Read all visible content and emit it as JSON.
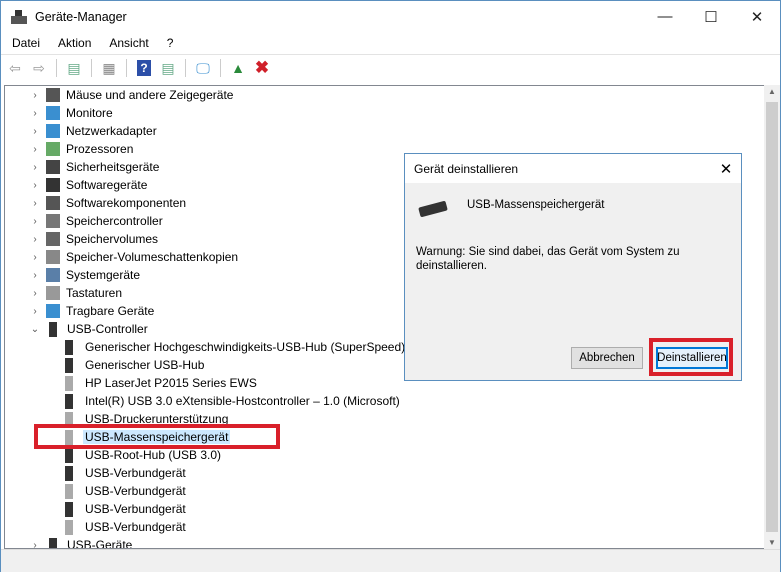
{
  "window": {
    "title": "Geräte-Manager",
    "minimize": "—",
    "maximize": "☐",
    "close": "✕"
  },
  "menu": [
    "Datei",
    "Aktion",
    "Ansicht",
    "?"
  ],
  "toolbar": {
    "icons": [
      "back-icon",
      "forward-icon",
      "show-hide-console-tree-icon",
      "properties-icon",
      "help-icon",
      "action-pane-icon",
      "scan-hardware-icon",
      "update-driver-icon",
      "uninstall-icon"
    ]
  },
  "tree": {
    "categories": [
      {
        "label": "Mäuse und andere Zeigegeräte",
        "icon": "mouse-icon"
      },
      {
        "label": "Monitore",
        "icon": "monitor-icon"
      },
      {
        "label": "Netzwerkadapter",
        "icon": "network-icon"
      },
      {
        "label": "Prozessoren",
        "icon": "processor-icon"
      },
      {
        "label": "Sicherheitsgeräte",
        "icon": "security-icon"
      },
      {
        "label": "Softwaregeräte",
        "icon": "software-device-icon"
      },
      {
        "label": "Softwarekomponenten",
        "icon": "software-component-icon"
      },
      {
        "label": "Speichercontroller",
        "icon": "storage-controller-icon"
      },
      {
        "label": "Speichervolumes",
        "icon": "storage-volume-icon"
      },
      {
        "label": "Speicher-Volumeschattenkopien",
        "icon": "shadow-copy-icon"
      },
      {
        "label": "Systemgeräte",
        "icon": "system-icon"
      },
      {
        "label": "Tastaturen",
        "icon": "keyboard-icon"
      },
      {
        "label": "Tragbare Geräte",
        "icon": "portable-device-icon"
      }
    ],
    "usb_controller": {
      "label": "USB-Controller",
      "children": [
        {
          "label": "Generischer Hochgeschwindigkeits-USB-Hub (SuperSpeed)",
          "hidden": false
        },
        {
          "label": "Generischer USB-Hub",
          "hidden": false
        },
        {
          "label": "HP LaserJet P2015 Series EWS",
          "hidden": true
        },
        {
          "label": "Intel(R) USB 3.0 eXtensible-Hostcontroller – 1.0 (Microsoft)",
          "hidden": false
        },
        {
          "label": "USB-Druckerunterstützung",
          "hidden": true
        },
        {
          "label": "USB-Massenspeichergerät",
          "hidden": true,
          "selected": true
        },
        {
          "label": "USB-Root-Hub (USB 3.0)",
          "hidden": false
        },
        {
          "label": "USB-Verbundgerät",
          "hidden": false
        },
        {
          "label": "USB-Verbundgerät",
          "hidden": true
        },
        {
          "label": "USB-Verbundgerät",
          "hidden": false
        },
        {
          "label": "USB-Verbundgerät",
          "hidden": true
        }
      ]
    },
    "usb_devices": {
      "label": "USB-Geräte"
    }
  },
  "dialog": {
    "title": "Gerät deinstallieren",
    "device": "USB-Massenspeichergerät",
    "warning": "Warnung: Sie sind dabei, das Gerät vom System zu deinstallieren.",
    "cancel": "Abbrechen",
    "confirm": "Deinstallieren"
  },
  "colors": {
    "highlight": "#d9202a",
    "selection": "#cce8ff",
    "accent": "#0078d7"
  }
}
